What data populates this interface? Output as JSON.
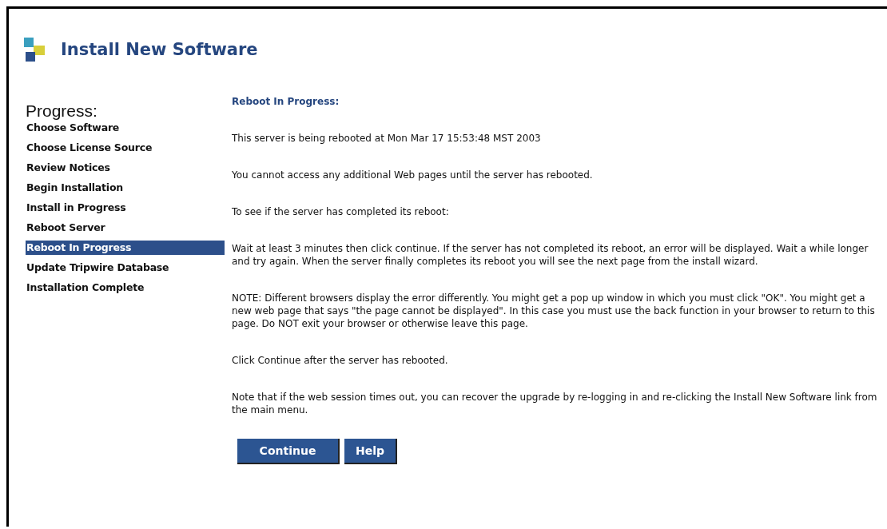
{
  "header": {
    "title": "Install New Software"
  },
  "progress": {
    "heading": "Progress:",
    "steps": [
      {
        "label": "Choose Software",
        "selected": false
      },
      {
        "label": "Choose License Source",
        "selected": false
      },
      {
        "label": "Review Notices",
        "selected": false
      },
      {
        "label": "Begin Installation",
        "selected": false
      },
      {
        "label": "Install in Progress",
        "selected": false
      },
      {
        "label": "Reboot Server",
        "selected": false
      },
      {
        "label": "Reboot In Progress",
        "selected": true
      },
      {
        "label": "Update Tripwire Database",
        "selected": false
      },
      {
        "label": "Installation Complete",
        "selected": false
      }
    ]
  },
  "content": {
    "heading": "Reboot In Progress:",
    "paragraphs": [
      "This server is being rebooted at Mon Mar 17 15:53:48 MST 2003",
      "You cannot access any additional Web pages until the server has rebooted.",
      "To see if the server has completed its reboot:",
      "Wait at least 3 minutes then click continue. If the server has not completed its reboot, an error will be displayed. Wait a while longer and try again. When the server finally completes its reboot you will see the next page from the install wizard.",
      "NOTE: Different browsers display the error differently. You might get a pop up window in which you must click \"OK\". You might get a new web page that says \"the page cannot be displayed\". In this case you must use the back function in your browser to return to this page. Do NOT exit your browser or otherwise leave this page.",
      "Click Continue after the server has rebooted.",
      "Note that if the web session times out, you can recover the upgrade by re-logging in and re-clicking the Install New Software link from the main menu."
    ]
  },
  "buttons": [
    "Continue",
    "Help"
  ]
}
